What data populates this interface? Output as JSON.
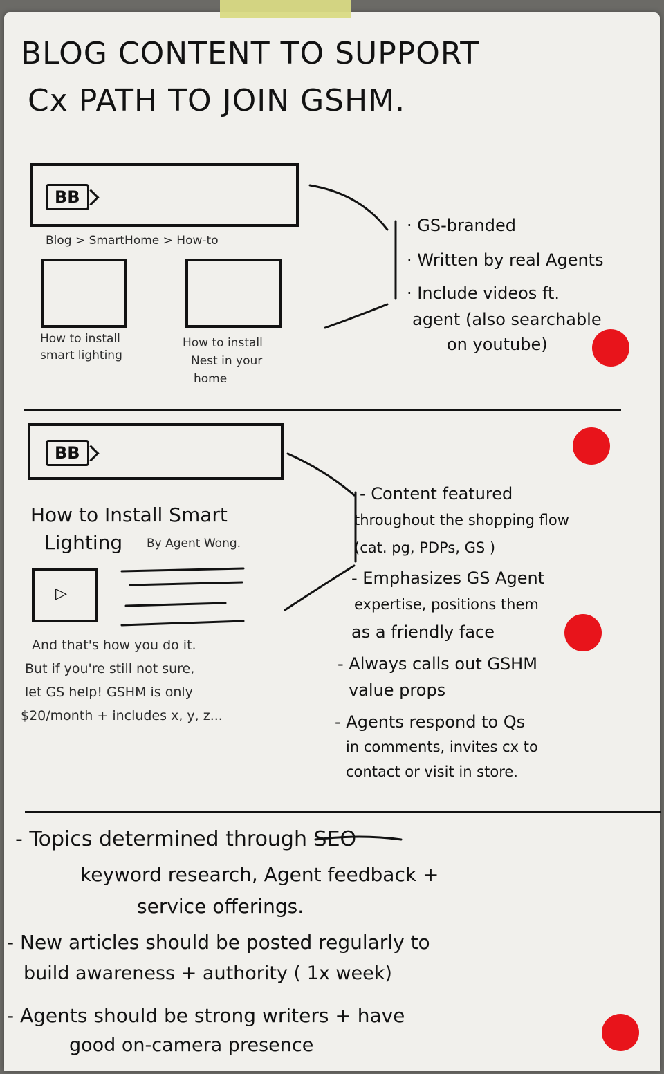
{
  "header": {
    "title_line1": "BLOG CONTENT TO SUPPORT",
    "title_line2": "Cx PATH TO JOIN GSHM."
  },
  "section1": {
    "logo": "BB",
    "breadcrumb": "Blog > SmartHome > How-to",
    "card1_caption_line1": "How to install",
    "card1_caption_line2": "smart lighting",
    "card2_caption_line1": "How to install",
    "card2_caption_line2": "Nest in your",
    "card2_caption_line3": "home",
    "notes": [
      "· GS-branded",
      "· Written by real Agents",
      "· Include videos ft.",
      "agent (also searchable",
      "on youtube)"
    ]
  },
  "section2": {
    "logo": "BB",
    "article_title_line1": "How to Install Smart",
    "article_title_line2": "Lighting",
    "byline": "By Agent Wong.",
    "play_icon": "play-icon",
    "body_line1": "And that's how you do it.",
    "body_line2": "But if you're still not sure,",
    "body_line3": "let GS help! GSHM is only",
    "body_line4": "$20/month + includes x, y, z...",
    "notes": [
      "- Content featured",
      "throughout the shopping flow",
      "(cat. pg, PDPs, GS )",
      "- Emphasizes GS Agent",
      "expertise, positions them",
      "as a friendly face",
      "- Always calls out GSHM",
      "value props",
      "- Agents respond to Qs",
      "in comments, invites cx to",
      "contact or visit in store."
    ]
  },
  "section3": {
    "notes": [
      "- Topics determined through SEO",
      "keyword research, Agent feedback +",
      "service offerings.",
      "- New articles should be posted regularly to",
      "build awareness + authority ( 1x week)",
      "- Agents should be strong writers + have",
      "good on-camera presence"
    ]
  },
  "colors": {
    "paper": "#f1f0ec",
    "ink": "#121212",
    "dot": "#e8141b",
    "tape": "#d9da84"
  }
}
